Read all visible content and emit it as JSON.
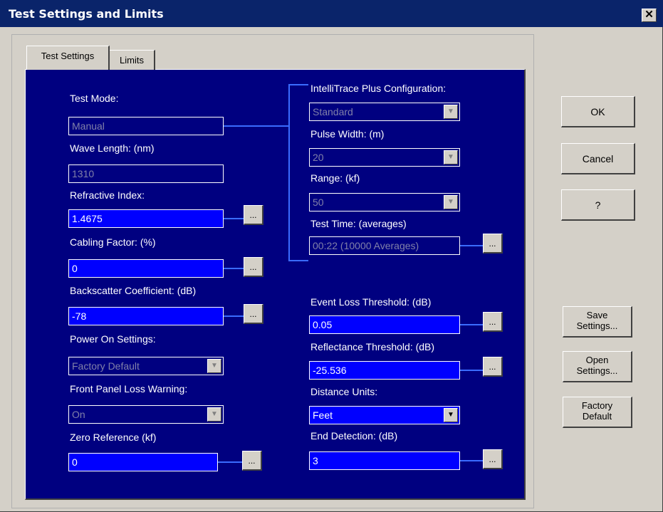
{
  "window": {
    "title": "Test Settings and Limits",
    "close_label": "✕"
  },
  "tabs": [
    {
      "label": "Test Settings",
      "active": true
    },
    {
      "label": "Limits",
      "active": false
    }
  ],
  "left": {
    "test_mode": {
      "label": "Test Mode:",
      "value": "Manual"
    },
    "wave_length": {
      "label": "Wave Length: (nm)",
      "value": "1310"
    },
    "refractive_index": {
      "label": "Refractive Index:",
      "value": "1.4675"
    },
    "cabling_factor": {
      "label": "Cabling Factor: (%)",
      "value": "0"
    },
    "backscatter": {
      "label": "Backscatter Coefficient: (dB)",
      "value": "-78"
    },
    "power_on": {
      "label": "Power On Settings:",
      "value": "Factory Default"
    },
    "front_panel": {
      "label": "Front Panel Loss Warning:",
      "value": "On"
    },
    "zero_reference": {
      "label": "Zero Reference (kf)",
      "value": "0"
    }
  },
  "right": {
    "intellitrace": {
      "label": "IntelliTrace Plus Configuration:",
      "value": "Standard"
    },
    "pulse_width": {
      "label": "Pulse Width: (m)",
      "value": "20"
    },
    "range": {
      "label": "Range: (kf)",
      "value": "50"
    },
    "test_time": {
      "label": "Test Time: (averages)",
      "value": "00:22 (10000 Averages)"
    },
    "event_loss": {
      "label": "Event Loss Threshold: (dB)",
      "value": "0.05"
    },
    "reflectance": {
      "label": "Reflectance Threshold: (dB)",
      "value": "-25.536"
    },
    "distance_units": {
      "label": "Distance Units:",
      "value": "Feet"
    },
    "end_detection": {
      "label": "End Detection: (dB)",
      "value": "3"
    }
  },
  "buttons": {
    "ok": "OK",
    "cancel": "Cancel",
    "help": "?",
    "save": "Save\nSettings...",
    "open": "Open\nSettings...",
    "factory": "Factory\nDefault",
    "ellipsis": "..."
  },
  "icons": {
    "dropdown": "▼"
  },
  "colors": {
    "panel_background": "#000080",
    "field_background": "#0000ff",
    "titlebar": "#0a246a",
    "dialog": "#d4d0c8"
  }
}
